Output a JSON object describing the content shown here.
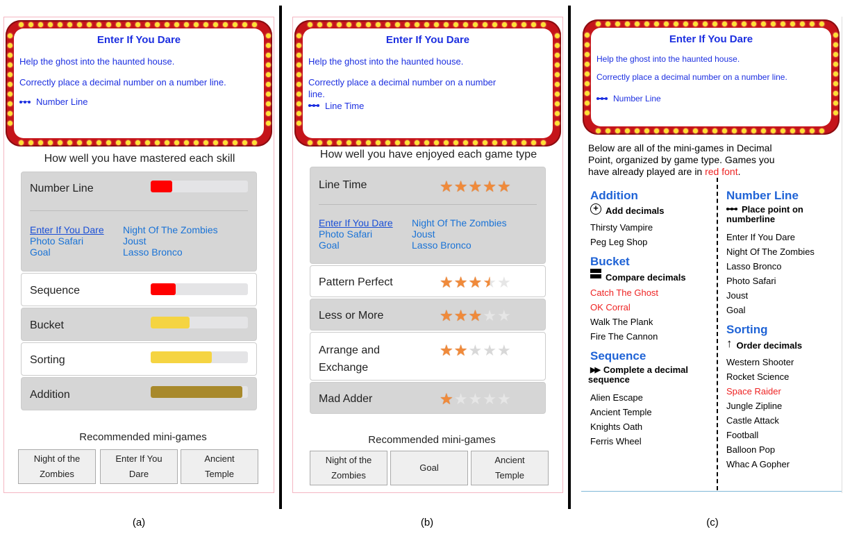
{
  "captions": [
    "(a)",
    "(b)",
    "(c)"
  ],
  "marquee": {
    "title": "Enter If You Dare",
    "line1": "Help the ghost into the haunted house.",
    "line2": "Correctly place a decimal number on a number line.",
    "line2_b_part1": "Correctly place a decimal number on a number",
    "line2_b_part2": "line.",
    "link_a": "Number Line",
    "link_b": "Line Time",
    "link_c": "Number Line",
    "colors": {
      "frame": "#c5141a",
      "bulb": "#ffe135",
      "text": "#1c2fe0"
    }
  },
  "panel_a": {
    "heading": "How well you have mastered each skill",
    "skills": [
      {
        "label": "Number Line",
        "fill": 0.22,
        "color": "#ff0000"
      },
      {
        "label": "Sequence",
        "fill": 0.26,
        "color": "#ff0000"
      },
      {
        "label": "Bucket",
        "fill": 0.4,
        "color": "#f5d442"
      },
      {
        "label": "Sorting",
        "fill": 0.63,
        "color": "#f5d442"
      },
      {
        "label": "Addition",
        "fill": 0.94,
        "color": "#a8892b"
      }
    ],
    "games": [
      "Enter If You Dare",
      "Night Of The Zombies",
      "Photo Safari",
      "Joust",
      "Goal",
      "Lasso Bronco"
    ],
    "rec_title": "Recommended mini-games",
    "rec": [
      {
        "l1": "Night of the",
        "l2": "Zombies"
      },
      {
        "l1": "Enter If You",
        "l2": "Dare"
      },
      {
        "l1": "Ancient",
        "l2": "Temple"
      }
    ]
  },
  "panel_b": {
    "heading": "How well you have enjoyed each game type",
    "types": [
      {
        "label": "Line Time",
        "rating": 5
      },
      {
        "label": "Pattern Perfect",
        "rating": 3.5
      },
      {
        "label": "Less or More",
        "rating": 3
      },
      {
        "label1": "Arrange and",
        "label2": "Exchange",
        "rating": 2
      },
      {
        "label": "Mad Adder",
        "rating": 1
      }
    ],
    "games": [
      "Enter If You Dare",
      "Night Of The Zombies",
      "Photo Safari",
      "Joust",
      "Goal",
      "Lasso Bronco"
    ],
    "rec_title": "Recommended mini-games",
    "rec": [
      {
        "l1": "Night of the",
        "l2": "Zombies"
      },
      {
        "l1": "Goal",
        "l2": ""
      },
      {
        "l1": "Ancient",
        "l2": "Temple"
      }
    ]
  },
  "panel_c": {
    "intro_1": "Below are all of the mini-games in Decimal",
    "intro_2": "Point, organized by game type. Games you",
    "intro_3a": "have already played are in ",
    "intro_3b": "red font",
    "intro_3c": ".",
    "left": [
      {
        "head": "Addition",
        "icon": "timer-plus-icon",
        "sub": [
          "Add decimals"
        ],
        "games": [
          [
            "Thirsty Vampire",
            false
          ],
          [
            "Peg Leg Shop",
            false
          ]
        ]
      },
      {
        "head": "Bucket",
        "icon": "bucket-bars-icon",
        "sub": [
          "Compare decimals"
        ],
        "games": [
          [
            "Catch The Ghost",
            true
          ],
          [
            "OK Corral",
            true
          ],
          [
            "Walk The Plank",
            false
          ],
          [
            "Fire The Cannon",
            false
          ]
        ]
      },
      {
        "head": "Sequence",
        "icon": "fast-forward-icon",
        "sub": [
          "Complete a decimal",
          "sequence"
        ],
        "games": [
          [
            "Alien Escape",
            false
          ],
          [
            "Ancient Temple",
            false
          ],
          [
            "Knights Oath",
            false
          ],
          [
            "Ferris Wheel",
            false
          ]
        ]
      }
    ],
    "right": [
      {
        "head": "Number Line",
        "icon": "number-line-icon",
        "sub": [
          "Place point on",
          "numberline"
        ],
        "games": [
          [
            "Enter If You Dare",
            false
          ],
          [
            "Night Of The Zombies",
            false
          ],
          [
            "Lasso Bronco",
            false
          ],
          [
            "Photo Safari",
            false
          ],
          [
            "Joust",
            false
          ],
          [
            "Goal",
            false
          ]
        ]
      },
      {
        "head": "Sorting",
        "icon": "up-arrow-icon",
        "sub": [
          "Order decimals"
        ],
        "games": [
          [
            "Western Shooter",
            false
          ],
          [
            "Rocket Science",
            false
          ],
          [
            "Space Raider",
            true
          ],
          [
            "Jungle Zipline",
            false
          ],
          [
            "Castle Attack",
            false
          ],
          [
            "Football",
            false
          ],
          [
            "Balloon Pop",
            false
          ],
          [
            "Whac A Gopher",
            false
          ]
        ]
      }
    ]
  }
}
